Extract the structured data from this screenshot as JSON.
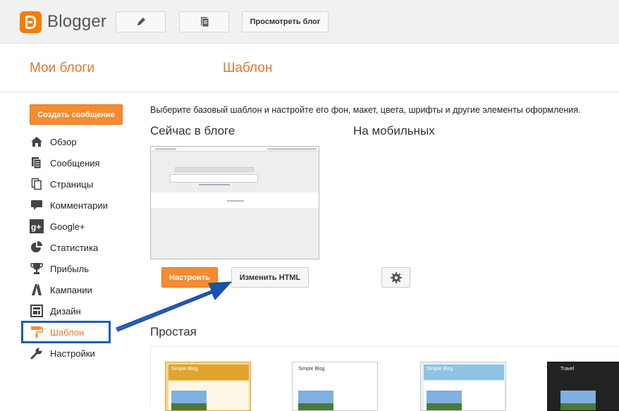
{
  "header": {
    "brand": "Blogger",
    "view_blog_label": "Просмотреть блог"
  },
  "subheader": {
    "my_blogs": "Мои блоги",
    "page_title": "Шаблон"
  },
  "sidebar": {
    "create_label": "Создать сообщение",
    "items": [
      {
        "label": "Обзор",
        "icon": "home-icon"
      },
      {
        "label": "Сообщения",
        "icon": "posts-icon"
      },
      {
        "label": "Страницы",
        "icon": "pages-icon"
      },
      {
        "label": "Комментарии",
        "icon": "comments-icon"
      },
      {
        "label": "Google+",
        "icon": "google-plus-icon"
      },
      {
        "label": "Статистика",
        "icon": "stats-icon"
      },
      {
        "label": "Прибыль",
        "icon": "trophy-icon"
      },
      {
        "label": "Кампании",
        "icon": "campaigns-icon"
      },
      {
        "label": "Дизайн",
        "icon": "layout-icon"
      },
      {
        "label": "Шаблон",
        "icon": "paint-roller-icon",
        "active": true
      },
      {
        "label": "Настройки",
        "icon": "wrench-icon"
      }
    ]
  },
  "main": {
    "intro": "Выберите базовый шаблон и настройте его фон, макет, цвета, шрифты и другие элементы оформления.",
    "now_title": "Сейчас в блоге",
    "mobile_title": "На мобильных",
    "customize_label": "Настроить",
    "edit_html_label": "Изменить HTML",
    "simple_title": "Простая",
    "thumbs": [
      {
        "title": "Simple Blog"
      },
      {
        "title": "Simple Blog"
      },
      {
        "title": "Simple Blog"
      },
      {
        "title": "Travel"
      }
    ]
  },
  "colors": {
    "accent": "#f58b33",
    "highlight": "#1d5fb0"
  }
}
